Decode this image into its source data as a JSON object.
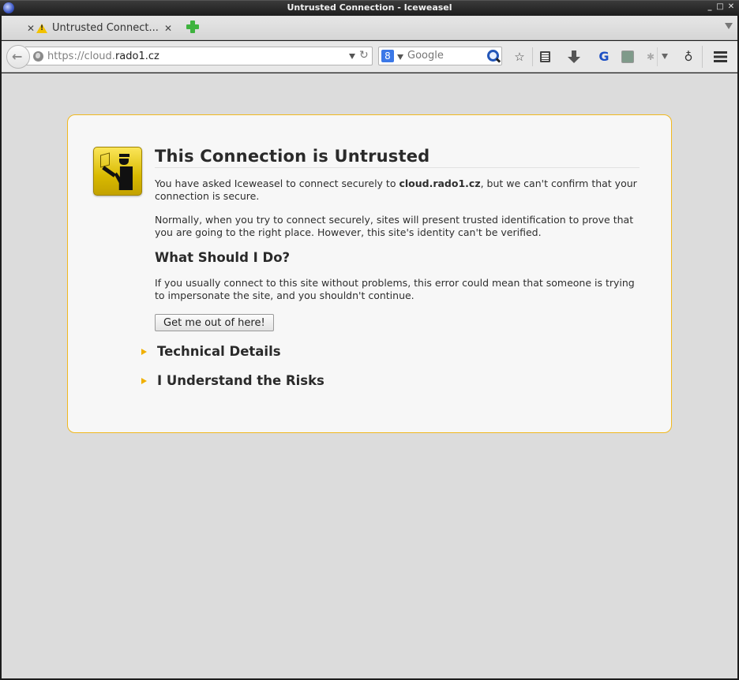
{
  "window": {
    "title": "Untrusted Connection - Iceweasel",
    "controls": {
      "minimize": "_",
      "maximize": "□",
      "close": "✕"
    }
  },
  "tabs": [
    {
      "label": "Untrusted Connect...",
      "icon": "warning-icon",
      "close": "✕",
      "left_close": "✕"
    }
  ],
  "tabstrip": {
    "new_tab": "new-tab-plus-icon",
    "list_all_tabs": "chevron-down-icon"
  },
  "navbar": {
    "url_scheme": "https://cloud.",
    "url_host": "rado1.cz",
    "reload_glyph": "↻",
    "back_glyph": "←",
    "search": {
      "engine": "Google",
      "engine_glyph": "8",
      "placeholder": "Google",
      "value": ""
    },
    "toolbar_icons": [
      "bookmark-star-icon",
      "reading-list-icon",
      "downloads-icon",
      "google-addon-icon",
      "evernote-icon",
      "addon-bug-icon",
      "addon-lamp-icon",
      "hamburger-menu-icon"
    ],
    "star_glyph": "☆",
    "addon1_glyph": "G",
    "addon3_glyph": "✱",
    "addon4_glyph": "♁"
  },
  "error_page": {
    "title": "This Connection is Untrusted",
    "p1_prefix": "You have asked Iceweasel to connect securely to ",
    "p1_host": "cloud.rado1.cz",
    "p1_suffix": ", but we can't confirm that your connection is secure.",
    "p2": "Normally, when you try to connect securely, sites will present trusted identification to prove that you are going to the right place. However, this site's identity can't be verified.",
    "subheading": "What Should I Do?",
    "p3": "If you usually connect to this site without problems, this error could mean that someone is trying to impersonate the site, and you shouldn't continue.",
    "get_out_button": "Get me out of here!",
    "expanders": [
      "Technical Details",
      "I Understand the Risks"
    ]
  },
  "colors": {
    "accent_border": "#f0b81f",
    "expander_arrow": "#f0b000",
    "page_bg": "#dcdcdc",
    "box_bg": "#f7f7f7"
  }
}
